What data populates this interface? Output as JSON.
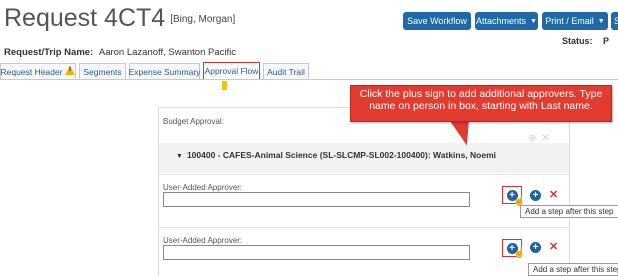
{
  "header": {
    "title": "Request 4CT4",
    "owner": "[Bing, Morgan]",
    "status_label": "Status:",
    "status_value": "P"
  },
  "toolbar": {
    "save_workflow": "Save Workflow",
    "attachments": "Attachments",
    "print_email": "Print / Email",
    "next_button": "S"
  },
  "trip": {
    "label": "Request/Trip Name:",
    "value": "Aaron Lazanoff, Swanton Pacific"
  },
  "tabs": [
    {
      "label": "Request Header",
      "active": false,
      "warning": true
    },
    {
      "label": "Segments",
      "active": false
    },
    {
      "label": "Expense Summary",
      "active": false
    },
    {
      "label": "Approval Flow",
      "active": true
    },
    {
      "label": "Audit Trail",
      "active": false
    }
  ],
  "approval": {
    "budget_label": "Budget Approval:",
    "cost_center": "100400 - CAFES-Animal Science (SL-SLCMP-SL002-100400):  Watkins, Noemi",
    "steps": [
      {
        "label": "User-Added Approver:",
        "value": "",
        "tooltip": "Add a step after this step"
      },
      {
        "label": "User-Added Approver:",
        "value": "",
        "tooltip": "Add a step after this step"
      }
    ]
  },
  "callout": {
    "text": "Click the plus sign to add additional approvers. Type name on person in box, starting with Last name."
  },
  "icons": {
    "plus": "plus-circle-icon",
    "remove": "x-icon",
    "warning": "warning-icon",
    "collapse": "triangle-down-icon"
  },
  "colors": {
    "primary_button": "#1f6aa6",
    "annotation_red": "#e23b30",
    "link_blue": "#245e9a"
  }
}
